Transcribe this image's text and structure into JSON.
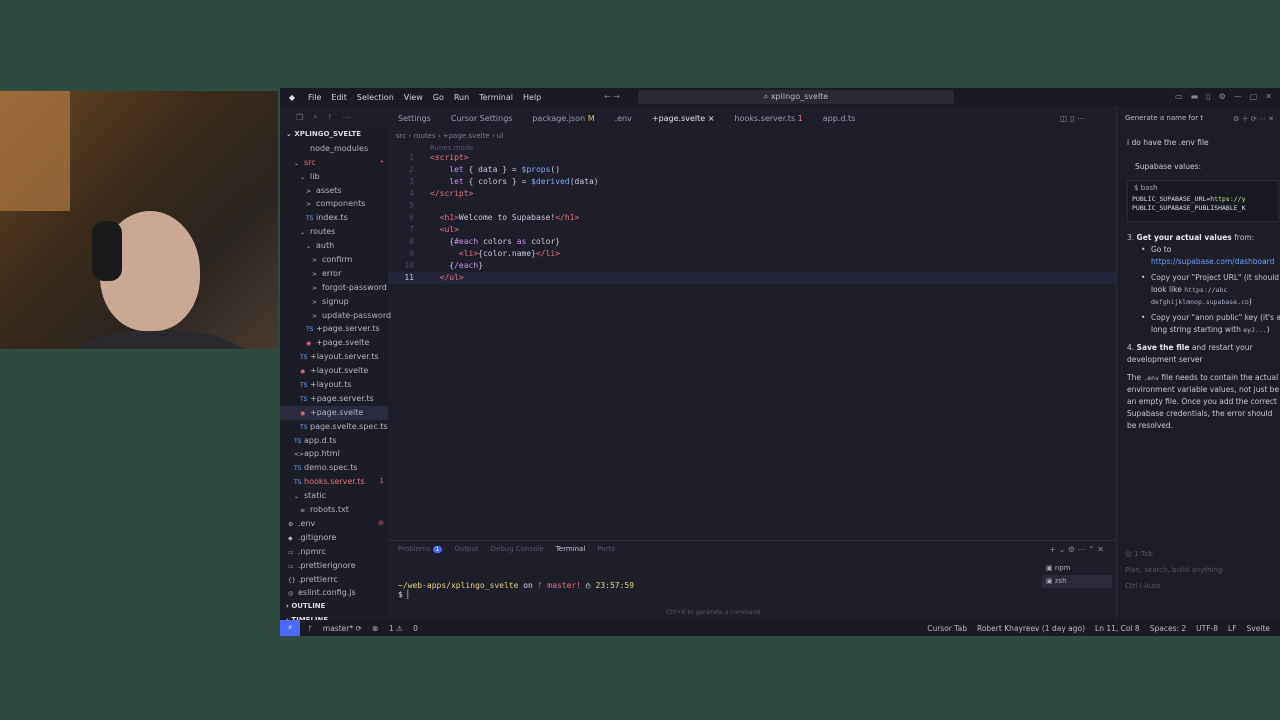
{
  "app": {
    "menu": [
      "File",
      "Edit",
      "Selection",
      "View",
      "Go",
      "Run",
      "Terminal",
      "Help"
    ],
    "search": "xplingo_svelte"
  },
  "tabs": [
    {
      "label": "Settings",
      "suffix": ""
    },
    {
      "label": "Cursor Settings",
      "suffix": ""
    },
    {
      "label": "package.json",
      "suffix": "M"
    },
    {
      "label": ".env",
      "suffix": ""
    },
    {
      "label": "+page.svelte",
      "suffix": "×"
    },
    {
      "label": "hooks.server.ts",
      "suffix": "1"
    },
    {
      "label": "app.d.ts",
      "suffix": ""
    }
  ],
  "explorer": {
    "root": "XPLINGO_SVELTE",
    "items": [
      {
        "label": "node_modules",
        "indent": 1,
        "icon": "",
        "cls": ""
      },
      {
        "label": "src",
        "indent": 0,
        "icon": "⌄",
        "cls": "red",
        "badge": "•"
      },
      {
        "label": "lib",
        "indent": 1,
        "icon": "⌄",
        "cls": ""
      },
      {
        "label": "assets",
        "indent": 2,
        "icon": ">",
        "cls": ""
      },
      {
        "label": "components",
        "indent": 2,
        "icon": ">",
        "cls": ""
      },
      {
        "label": "index.ts",
        "indent": 2,
        "icon": "TS",
        "cls": ""
      },
      {
        "label": "routes",
        "indent": 1,
        "icon": "⌄",
        "cls": ""
      },
      {
        "label": "auth",
        "indent": 2,
        "icon": "⌄",
        "cls": ""
      },
      {
        "label": "confirm",
        "indent": 3,
        "icon": ">",
        "cls": ""
      },
      {
        "label": "error",
        "indent": 3,
        "icon": ">",
        "cls": ""
      },
      {
        "label": "forgot-password",
        "indent": 3,
        "icon": ">",
        "cls": ""
      },
      {
        "label": "signup",
        "indent": 3,
        "icon": ">",
        "cls": ""
      },
      {
        "label": "update-password",
        "indent": 3,
        "icon": ">",
        "cls": ""
      },
      {
        "label": "+page.server.ts",
        "indent": 2,
        "icon": "TS",
        "cls": ""
      },
      {
        "label": "+page.svelte",
        "indent": 2,
        "icon": "◉",
        "cls": ""
      },
      {
        "label": "+layout.server.ts",
        "indent": 1,
        "icon": "TS",
        "cls": ""
      },
      {
        "label": "+layout.svelte",
        "indent": 1,
        "icon": "◉",
        "cls": ""
      },
      {
        "label": "+layout.ts",
        "indent": 1,
        "icon": "TS",
        "cls": ""
      },
      {
        "label": "+page.server.ts",
        "indent": 1,
        "icon": "TS",
        "cls": ""
      },
      {
        "label": "+page.svelte",
        "indent": 1,
        "icon": "◉",
        "cls": "",
        "sel": true
      },
      {
        "label": "page.svelte.spec.ts",
        "indent": 1,
        "icon": "TS",
        "cls": ""
      },
      {
        "label": "app.d.ts",
        "indent": 0,
        "icon": "TS",
        "cls": ""
      },
      {
        "label": "app.html",
        "indent": 0,
        "icon": "<>",
        "cls": ""
      },
      {
        "label": "demo.spec.ts",
        "indent": 0,
        "icon": "TS",
        "cls": ""
      },
      {
        "label": "hooks.server.ts",
        "indent": 0,
        "icon": "TS",
        "cls": "red",
        "badge": "1"
      },
      {
        "label": "static",
        "indent": 0,
        "icon": "⌄",
        "cls": ""
      },
      {
        "label": "robots.txt",
        "indent": 1,
        "icon": "≡",
        "cls": ""
      },
      {
        "label": ".env",
        "indent": -1,
        "icon": "⚙",
        "cls": "",
        "badge": "⊘"
      },
      {
        "label": ".gitignore",
        "indent": -1,
        "icon": "◆",
        "cls": ""
      },
      {
        "label": ".npmrc",
        "indent": -1,
        "icon": "▭",
        "cls": ""
      },
      {
        "label": ".prettierignore",
        "indent": -1,
        "icon": "▭",
        "cls": ""
      },
      {
        "label": ".prettierrc",
        "indent": -1,
        "icon": "{}",
        "cls": ""
      },
      {
        "label": "eslint.config.js",
        "indent": -1,
        "icon": "◎",
        "cls": ""
      }
    ],
    "outline": "OUTLINE",
    "timeline": "TIMELINE"
  },
  "editor": {
    "breadcrumb": "src  ›  routes  ›  +page.svelte  ›  ul",
    "runes": "Runes mode",
    "lines": [
      {
        "n": "1",
        "html": "<span class='tag'>&lt;script&gt;</span>"
      },
      {
        "n": "2",
        "html": "    <span class='kw'>let</span> { data } = <span class='fn'>$props</span>()"
      },
      {
        "n": "3",
        "html": "    <span class='kw'>let</span> { colors } = <span class='fn'>$derived</span>(data)"
      },
      {
        "n": "4",
        "html": "<span class='tag'>&lt;/script&gt;</span>"
      },
      {
        "n": "5",
        "html": ""
      },
      {
        "n": "6",
        "html": "  <span class='tag'>&lt;h1&gt;</span>Welcome to Supabase!<span class='tag'>&lt;/h1&gt;</span>"
      },
      {
        "n": "7",
        "html": "  <span class='tag'>&lt;ul&gt;</span>"
      },
      {
        "n": "8",
        "html": "    {<span class='kw'>#each</span> colors <span class='kw'>as</span> color}"
      },
      {
        "n": "9",
        "html": "      <span class='tag'>&lt;li&gt;</span>{color.name}<span class='tag'>&lt;/li&gt;</span>"
      },
      {
        "n": "10",
        "html": "    {<span class='kw'>/each</span>}"
      },
      {
        "n": "11",
        "html": "  <span class='tag'>&lt;/ul&gt;</span>"
      }
    ]
  },
  "panel": {
    "tabs": [
      "Problems",
      "Output",
      "Debug Console",
      "Terminal",
      "Ports"
    ],
    "problems_count": "1",
    "prompt_path": "~/web-apps/xplingo_svelte",
    "prompt_on": " on ",
    "prompt_branch": "ᚠ master!",
    "prompt_time": "23:57:59",
    "prompt_symbol": "$",
    "hint": "Ctrl+K to generate a command",
    "shells": [
      "npm",
      "zsh"
    ]
  },
  "chat": {
    "header": "Generate a name for t",
    "question": "i do have the .env file",
    "values_label": "Supabase values:",
    "code_lang": "bash",
    "code_lines": [
      {
        "k": "PUBLIC_SUPABASE_URL=",
        "v": "https://y"
      },
      {
        "k": "PUBLIC_SUPABASE_PUBLISHABLE_K",
        "v": ""
      }
    ],
    "step3_title": "Get your actual values",
    "step3_suffix": " from:",
    "step3_a": "Go to",
    "step3_link": "https://supabase.com/dashboard",
    "step3_b": "Copy your \"Project URL\" (it should look like",
    "step3_b_code": "https://abc defghijklmnop.supabase.co",
    "step3_c": "Copy your \"anon public\" key (it's a long string starting with",
    "step3_c_code": "eyJ...",
    "step4_title": "Save the file",
    "step4_suffix": " and restart your development server",
    "final_pre": "The ",
    "final_code": ".env",
    "final_post": " file needs to contain the actual environment variable values, not just be an empty file. Once you add the correct Supabase credentials, the error should be resolved.",
    "input_tabs": "1 Tab",
    "input_placeholder": "Plan, search, build anything",
    "input_mode": "Ctrl I",
    "input_model": "Auto"
  },
  "status": {
    "branch": "master*",
    "errors": "1",
    "warnings": "0",
    "right": [
      "Cursor Tab",
      "Robert Khayreev (1 day ago)",
      "Ln 11, Col 8",
      "Spaces: 2",
      "UTF-8",
      "LF",
      "Svelte"
    ]
  }
}
